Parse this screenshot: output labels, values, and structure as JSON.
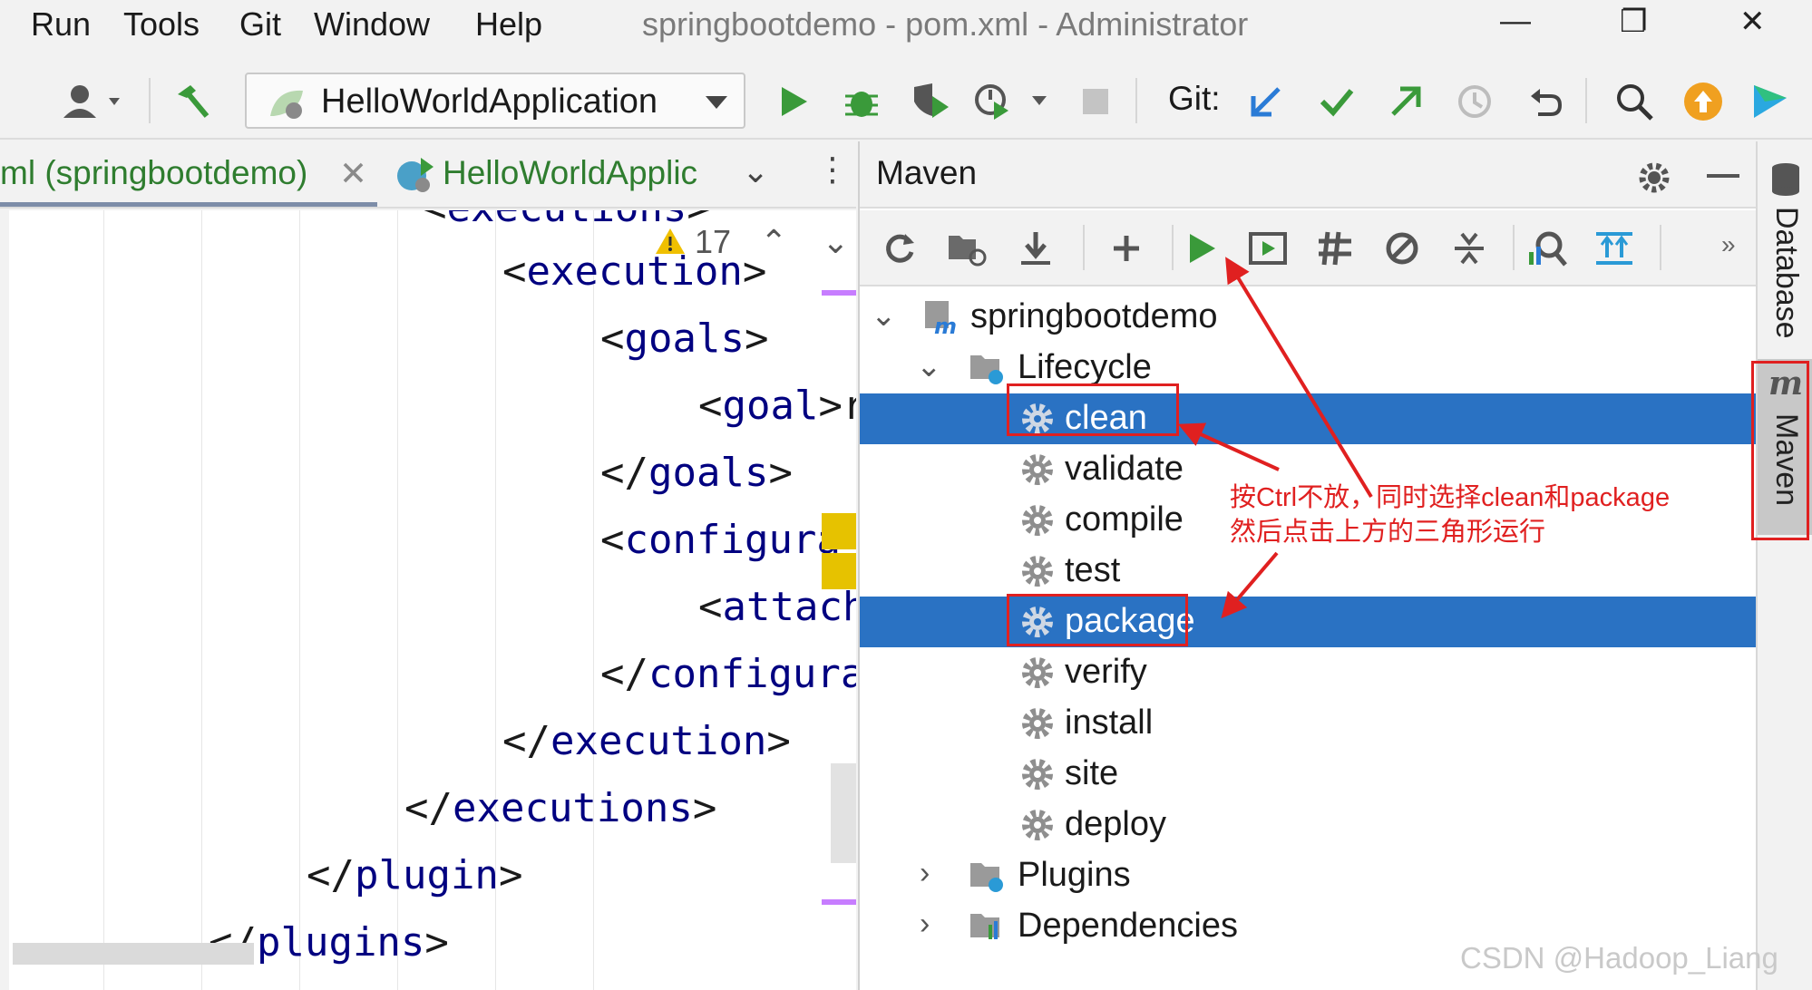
{
  "menu": {
    "run": "Run",
    "tools": "Tools",
    "git": "Git",
    "window": "Window",
    "help": "Help"
  },
  "window_title": "springbootdemo - pom.xml - Administrator",
  "toolbar": {
    "run_config": "HelloWorldApplication",
    "git_label": "Git:"
  },
  "editor_tabs": {
    "tab1": "ml (springbootdemo)",
    "tab2": "HelloWorldApplic"
  },
  "editor": {
    "warning_count": "17",
    "lines": [
      {
        "pre": "<",
        "tag": "executions",
        "post": ">"
      },
      {
        "pre": "<",
        "tag": "execution",
        "post": ">"
      },
      {
        "pre": "<",
        "tag": "goals",
        "post": ">"
      },
      {
        "pre": "<",
        "tag": "goal",
        "post": ">r"
      },
      {
        "pre": "</",
        "tag": "goals",
        "post": ">"
      },
      {
        "pre": "<",
        "tag": "configura",
        "post": ""
      },
      {
        "pre": "<",
        "tag": "attach",
        "post": ""
      },
      {
        "pre": "</",
        "tag": "configura",
        "post": ""
      },
      {
        "pre": "</",
        "tag": "execution",
        "post": ">"
      },
      {
        "pre": "</",
        "tag": "executions",
        "post": ">"
      },
      {
        "pre": "</",
        "tag": "plugin",
        "post": ">"
      },
      {
        "pre": "</",
        "tag": "plugins",
        "post": ">"
      }
    ]
  },
  "maven": {
    "title": "Maven",
    "project": "springbootdemo",
    "lifecycle": "Lifecycle",
    "goals": [
      "clean",
      "validate",
      "compile",
      "test",
      "package",
      "verify",
      "install",
      "site",
      "deploy"
    ],
    "selected": [
      "clean",
      "package"
    ],
    "plugins": "Plugins",
    "dependencies": "Dependencies"
  },
  "annotation": {
    "line1": "按Ctrl不放，同时选择clean和package",
    "line2": "然后点击上方的三角形运行"
  },
  "side": {
    "database": "Database",
    "maven": "Maven"
  },
  "watermark": "CSDN @Hadoop_Liang",
  "colors": {
    "selection": "#2a72c3",
    "run_green": "#3a9a3a",
    "annotation_red": "#e02020",
    "tag_blue": "#000080"
  }
}
